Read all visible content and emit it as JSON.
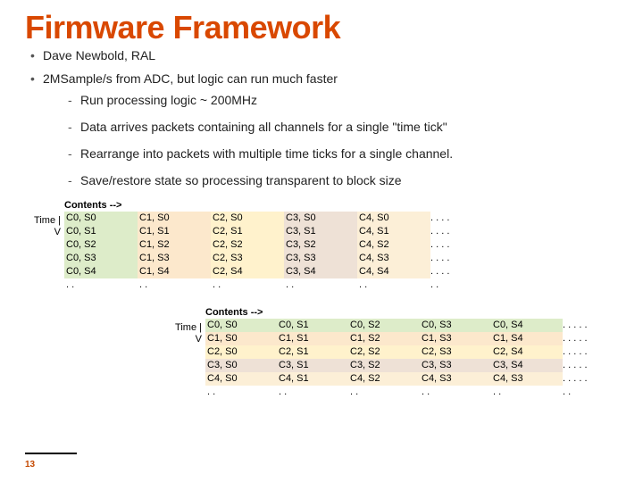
{
  "title": "Firmware Framework",
  "bullets": {
    "b1": "Dave Newbold, RAL",
    "b2": "2MSample/s from ADC, but logic can run much faster",
    "sub": {
      "s1": "Run processing logic ~ 200MHz",
      "s2": "Data arrives packets containing all channels for a single \"time tick\"",
      "s3": "Rearrange into packets with multiple time ticks for a single channel.",
      "s4": "Save/restore state so processing transparent to block size"
    }
  },
  "labels": {
    "contents": "Contents -->",
    "time": "Time |",
    "v": "V",
    "ellipsis5": ". . . . .",
    "ellipsis4": ". . . .",
    "dd": ". ."
  },
  "table1": {
    "rows": [
      [
        "C0, S0",
        "C1, S0",
        "C2, S0",
        "C3, S0",
        "C4, S0"
      ],
      [
        "C0, S1",
        "C1, S1",
        "C2, S1",
        "C3, S1",
        "C4, S1"
      ],
      [
        "C0, S2",
        "C1, S2",
        "C2, S2",
        "C3, S2",
        "C4, S2"
      ],
      [
        "C0, S3",
        "C1, S3",
        "C2, S3",
        "C3, S3",
        "C4, S3"
      ],
      [
        "C0, S4",
        "C1, S4",
        "C2, S4",
        "C3, S4",
        "C4, S4"
      ]
    ]
  },
  "table2": {
    "rows": [
      [
        "C0, S0",
        "C0, S1",
        "C0, S2",
        "C0, S3",
        "C0, S4"
      ],
      [
        "C1, S0",
        "C1, S1",
        "C1, S2",
        "C1, S3",
        "C1, S4"
      ],
      [
        "C2, S0",
        "C2, S1",
        "C2, S2",
        "C2, S3",
        "C2, S4"
      ],
      [
        "C3, S0",
        "C3, S1",
        "C3, S2",
        "C3, S3",
        "C3, S4"
      ],
      [
        "C4, S0",
        "C4, S1",
        "C4, S2",
        "C4, S3",
        "C4, S3"
      ]
    ]
  },
  "page": "13"
}
